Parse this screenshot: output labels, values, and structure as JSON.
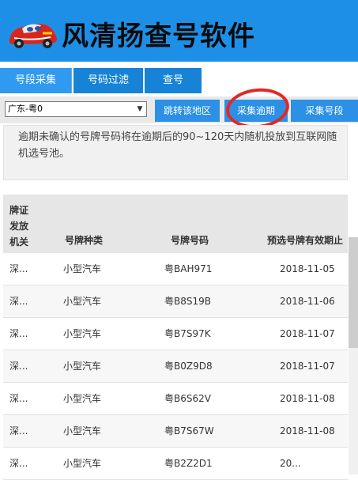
{
  "app": {
    "title": "风清扬查号软件"
  },
  "tabs": [
    {
      "label": "号段采集"
    },
    {
      "label": "号码过滤"
    },
    {
      "label": "查号"
    }
  ],
  "toolbar": {
    "region_value": "广东-粤0",
    "jump_label": "跳转该地区",
    "collect_overdue_label": "采集逾期",
    "collect_segment_label": "采集号段"
  },
  "notice": "逾期未确认的号牌号码将在逾期后的90~120天内随机投放到互联网随机选号池。",
  "table": {
    "headers": [
      "牌证发放机关",
      "号牌种类",
      "号牌号码",
      "预选号牌有效期止"
    ],
    "rows": [
      {
        "authority": "深...",
        "type": "小型汽车",
        "plate": "粤BAH971",
        "expiry": "2018-11-05"
      },
      {
        "authority": "深...",
        "type": "小型汽车",
        "plate": "粤B8S19B",
        "expiry": "2018-11-06"
      },
      {
        "authority": "深...",
        "type": "小型汽车",
        "plate": "粤B7S97K",
        "expiry": "2018-11-07"
      },
      {
        "authority": "深...",
        "type": "小型汽车",
        "plate": "粤B0Z9D8",
        "expiry": "2018-11-07"
      },
      {
        "authority": "深...",
        "type": "小型汽车",
        "plate": "粤B6S62V",
        "expiry": "2018-11-08"
      },
      {
        "authority": "深...",
        "type": "小型汽车",
        "plate": "粤B7S67W",
        "expiry": "2018-11-08"
      },
      {
        "authority": "深...",
        "type": "小型汽车",
        "plate": "粤B2Z2D1",
        "expiry": "20..."
      }
    ]
  },
  "icons": {
    "logo": "race-car-logo-icon",
    "dropdown": "chevron-down-icon"
  },
  "colors": {
    "brand_blue": "#1e8fe6",
    "highlight_red": "#e32626"
  }
}
